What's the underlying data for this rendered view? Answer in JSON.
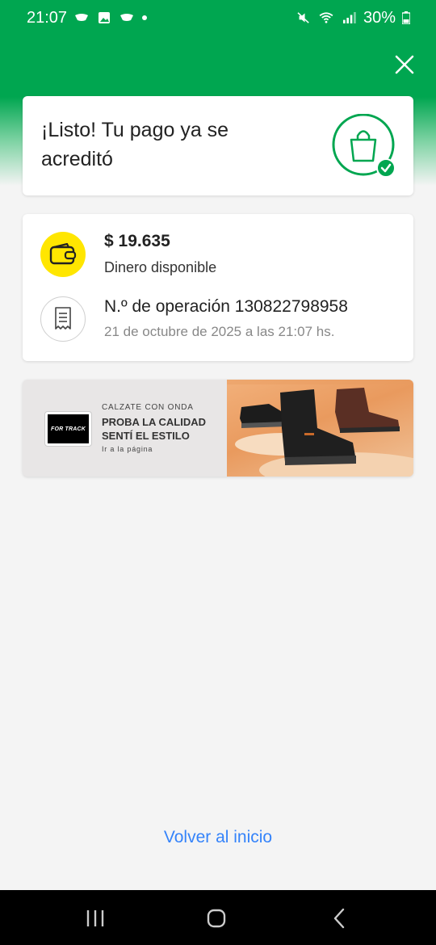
{
  "status_bar": {
    "time": "21:07",
    "battery": "30%",
    "icons": [
      "notification-icon",
      "gallery-icon",
      "notification-icon",
      "dot-icon",
      "mute-icon",
      "wifi-icon",
      "signal-icon",
      "battery-icon"
    ]
  },
  "header": {
    "close_icon": "close-icon"
  },
  "success_card": {
    "title": "¡Listo! Tu pago ya se acreditó",
    "icon": "shopping-bag-check-icon",
    "accent": "#00a650"
  },
  "info_card": {
    "amount": "$ 19.635",
    "amount_label": "Dinero disponible",
    "operation": "N.º de operación 130822798958",
    "date": "21 de octubre de 2025 a las 21:07 hs.",
    "wallet_icon": "wallet-icon",
    "receipt_icon": "receipt-icon"
  },
  "ad": {
    "logo_text": "FOR TRACK",
    "kicker": "CALZATE CON ONDA",
    "title": "PROBA LA CALIDAD SENTÍ EL ESTILO",
    "cta": "Ir a la página",
    "image": "work-boots-image"
  },
  "footer": {
    "back_link": "Volver al inicio"
  },
  "nav": {
    "icons": [
      "recents-icon",
      "home-icon",
      "back-icon"
    ]
  },
  "colors": {
    "brand_green": "#00a650",
    "link_blue": "#3483fa",
    "wallet_yellow": "#ffe600"
  }
}
